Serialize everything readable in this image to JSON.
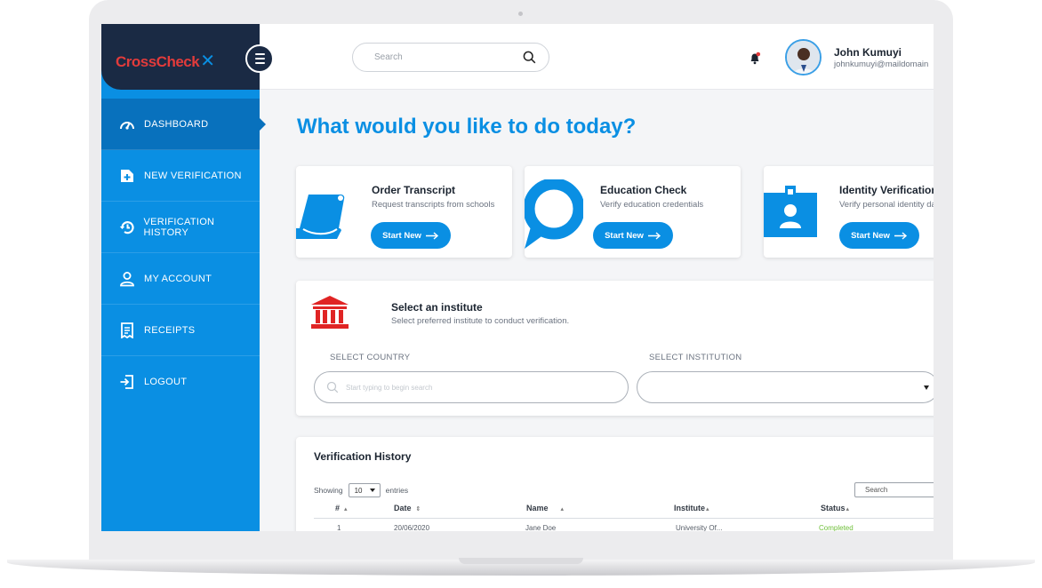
{
  "brand": {
    "logo_text": "CrossCheck",
    "logo_mark": "✕"
  },
  "sidebar": {
    "items": [
      {
        "label": "DASHBOARD",
        "icon": "dashboard-gauge-icon",
        "active": true
      },
      {
        "label": "NEW VERIFICATION",
        "icon": "add-file-icon",
        "active": false
      },
      {
        "label": "VERIFICATION HISTORY",
        "icon": "history-icon",
        "active": false
      },
      {
        "label": "MY ACCOUNT",
        "icon": "user-icon",
        "active": false
      },
      {
        "label": "RECEIPTS",
        "icon": "receipt-icon",
        "active": false
      },
      {
        "label": "LOGOUT",
        "icon": "logout-icon",
        "active": false
      }
    ]
  },
  "header": {
    "search_placeholder": "Search",
    "user": {
      "name": "John Kumuyi",
      "email": "johnkumuyi@maildomain"
    }
  },
  "main": {
    "heading": "What would you like to do today?",
    "cards": [
      {
        "title": "Order Transcript",
        "description": "Request transcripts from schools",
        "button": "Start New",
        "icon": "scroll-icon"
      },
      {
        "title": "Education Check",
        "description": "Verify education credentials",
        "button": "Start New",
        "icon": "magnifier-icon"
      },
      {
        "title": "Identity Verification",
        "description": "Verify personal identity data",
        "button": "Start New",
        "icon": "id-badge-icon"
      }
    ],
    "institute": {
      "title": "Select an institute",
      "description": "Select preferred institute to conduct verification.",
      "country_label": "SELECT COUNTRY",
      "country_placeholder": "Start typing to begin search",
      "institution_label": "SELECT INSTITUTION",
      "institution_value": ""
    },
    "history": {
      "title": "Verification History",
      "showing_label": "Showing",
      "entries_value": "10",
      "entries_label": "entries",
      "search_label": "Search",
      "columns": [
        "#",
        "Date",
        "Name",
        "Institute",
        "Status"
      ],
      "rows": [
        {
          "num": "1",
          "date": "20/06/2020",
          "name": "Jane Doe",
          "institute": "University Of...",
          "status": "Completed"
        }
      ]
    }
  },
  "colors": {
    "primary": "#0a8fe3",
    "sidebar_active": "#0871bd",
    "brand_dark": "#1a2a44",
    "logo_red": "#e23b3b",
    "status_completed": "#6fbf3a"
  }
}
